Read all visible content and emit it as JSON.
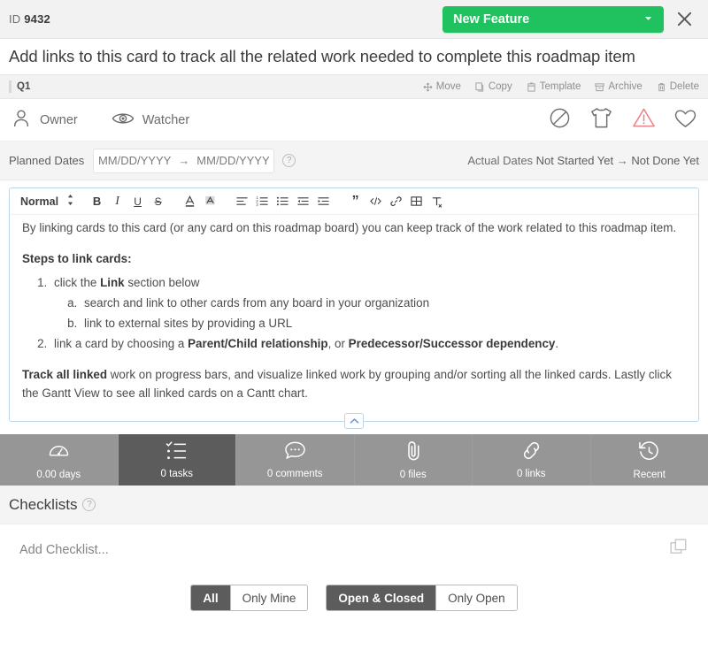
{
  "header": {
    "id_prefix": "ID",
    "id_value": "9432",
    "type_label": "New Feature",
    "type_color": "#1fc25e",
    "caret_icon": "chevron-down-icon",
    "close_icon": "close-icon"
  },
  "title": "Add links to this card to track all the related work needed to complete this roadmap item",
  "actions": {
    "board_label": "Q1",
    "items": [
      {
        "label": "Move",
        "icon": "move-icon"
      },
      {
        "label": "Copy",
        "icon": "copy-icon"
      },
      {
        "label": "Template",
        "icon": "template-icon"
      },
      {
        "label": "Archive",
        "icon": "archive-icon"
      },
      {
        "label": "Delete",
        "icon": "trash-icon"
      }
    ]
  },
  "people": {
    "owner_label": "Owner",
    "owner_icon": "user-icon",
    "watcher_label": "Watcher",
    "watcher_icon": "eye-icon",
    "flags": [
      {
        "name": "blocked-icon"
      },
      {
        "name": "tshirt-size-icon"
      },
      {
        "name": "warning-icon",
        "color": "#e8828c"
      },
      {
        "name": "heart-icon"
      }
    ]
  },
  "dates": {
    "planned_label": "Planned Dates",
    "start_placeholder": "MM/DD/YYYY",
    "arrow": "→",
    "end_placeholder": "MM/DD/YYYY",
    "help_icon": "question-icon",
    "actual_label": "Actual Dates",
    "actual_start": "Not Started Yet",
    "actual_arrow": "→",
    "actual_end": "Not Done Yet"
  },
  "editor": {
    "style_select": "Normal",
    "toolbar": [
      "bold-icon",
      "italic-icon",
      "underline-icon",
      "strikethrough-icon",
      "text-color-icon",
      "highlight-icon",
      "align-icon",
      "ordered-list-icon",
      "bullet-list-icon",
      "outdent-icon",
      "indent-icon",
      "blockquote-icon",
      "code-icon",
      "link-icon",
      "table-icon",
      "clear-format-icon"
    ],
    "collapse_icon": "chevron-up-icon",
    "body": {
      "intro": "By linking cards to this card (or any card on this roadmap board) you can keep track of the work related to this roadmap item.",
      "steps_heading": "Steps to link cards:",
      "step1_pre": "click the ",
      "step1_bold": "Link",
      "step1_post": " section below",
      "step1a": "search and link to other cards from any board in your organization",
      "step1b": "link to external sites by providing a URL",
      "step2_pre": "link a card by choosing a ",
      "step2_bold1": "Parent/Child relationship",
      "step2_mid": ", or ",
      "step2_bold2": "Predecessor/Successor dependency",
      "step2_post": ".",
      "outro_bold": "Track all linked",
      "outro_rest": " work on progress bars, and visualize linked work by grouping and/or sorting all the linked cards. Lastly click the Gantt View to see all linked cards on a Cantt chart."
    }
  },
  "tabs": [
    {
      "label": "0.00 days",
      "icon": "gauge-icon",
      "active": false
    },
    {
      "label": "0 tasks",
      "icon": "checklist-icon",
      "active": true
    },
    {
      "label": "0 comments",
      "icon": "comment-icon",
      "active": false
    },
    {
      "label": "0 files",
      "icon": "paperclip-icon",
      "active": false
    },
    {
      "label": "0 links",
      "icon": "chain-link-icon",
      "active": false
    },
    {
      "label": "Recent",
      "icon": "history-icon",
      "active": false
    }
  ],
  "checklists": {
    "heading": "Checklists",
    "help_icon": "question-icon",
    "add_placeholder": "Add Checklist...",
    "copy_icon": "duplicate-icon",
    "filter_scope": [
      {
        "label": "All",
        "active": true
      },
      {
        "label": "Only Mine",
        "active": false
      }
    ],
    "filter_state": [
      {
        "label": "Open & Closed",
        "active": true
      },
      {
        "label": "Only Open",
        "active": false
      }
    ]
  }
}
